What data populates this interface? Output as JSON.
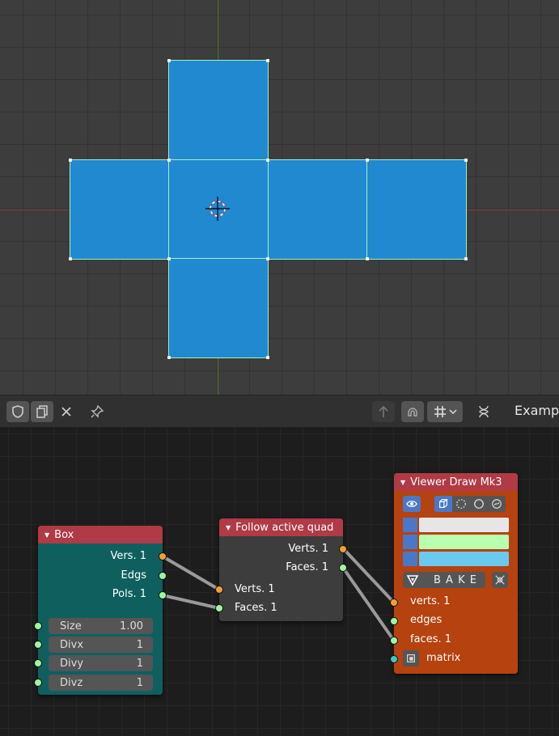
{
  "viewport": {
    "face_color": "#2189d0",
    "edge_color": "#9ff4c2"
  },
  "header": {
    "title": "Examp",
    "icons": [
      "shield-icon",
      "copy-icon",
      "close-icon",
      "pin-icon",
      "arrow-up-icon",
      "snap-magnet-icon",
      "snap-grid-icon",
      "chevron-down-icon",
      "dna-icon"
    ]
  },
  "nodes": {
    "box": {
      "title": "Box",
      "outputs": [
        "Vers. 1",
        "Edgs",
        "Pols. 1"
      ],
      "fields": [
        {
          "label": "Size",
          "value": "1.00"
        },
        {
          "label": "Divx",
          "value": "1"
        },
        {
          "label": "Divy",
          "value": "1"
        },
        {
          "label": "Divz",
          "value": "1"
        }
      ]
    },
    "follow": {
      "title": "Follow active quad",
      "outputs": [
        "Verts. 1",
        "Faces. 1"
      ],
      "inputs": [
        "Verts. 1",
        "Faces. 1"
      ]
    },
    "viewer": {
      "title": "Viewer Draw Mk3",
      "bake_label": "B A K E",
      "inputs": [
        "verts. 1",
        "edges",
        "faces. 1",
        "matrix"
      ],
      "color_bars": [
        "#e6e6e6",
        "#b9ffb0",
        "#6cc9ee"
      ]
    }
  }
}
